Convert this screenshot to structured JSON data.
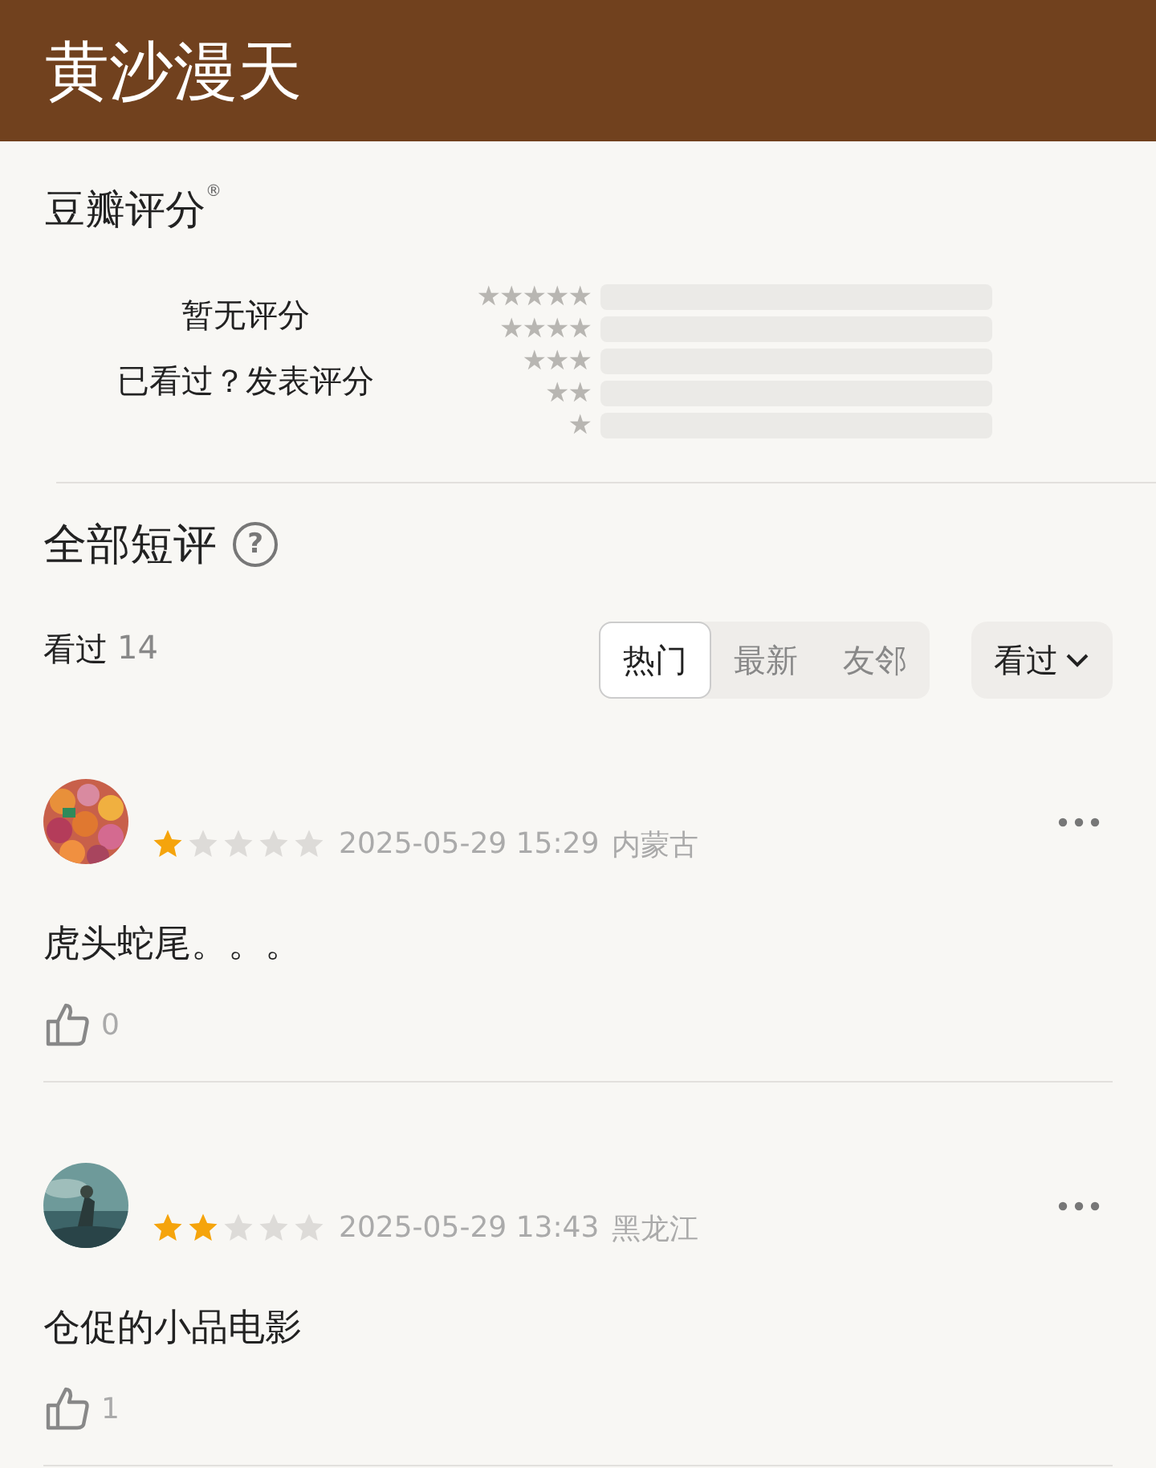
{
  "header": {
    "title": "黄沙漫天"
  },
  "rating": {
    "title": "豆瓣评分",
    "mark": "®",
    "empty_text": "暂无评分",
    "prompt": "已看过？发表评分",
    "bars": [
      {
        "label": "★★★★★"
      },
      {
        "label": "★★★★"
      },
      {
        "label": "★★★"
      },
      {
        "label": "★★"
      },
      {
        "label": "★"
      }
    ]
  },
  "comments_section": {
    "title": "全部短评",
    "help_icon": "?",
    "filter_label": "看过",
    "count": "14",
    "tabs": [
      {
        "label": "热门",
        "selected": true
      },
      {
        "label": "最新",
        "selected": false
      },
      {
        "label": "友邻",
        "selected": false
      }
    ],
    "dropdown": {
      "label": "看过"
    }
  },
  "comments": [
    {
      "stars": 1,
      "time": "2025-05-29 15:29",
      "region": "内蒙古",
      "text": "虎头蛇尾。。。",
      "likes": "0"
    },
    {
      "stars": 2,
      "time": "2025-05-29 13:43",
      "region": "黑龙江",
      "text": "仓促的小品电影",
      "likes": "1"
    }
  ]
}
